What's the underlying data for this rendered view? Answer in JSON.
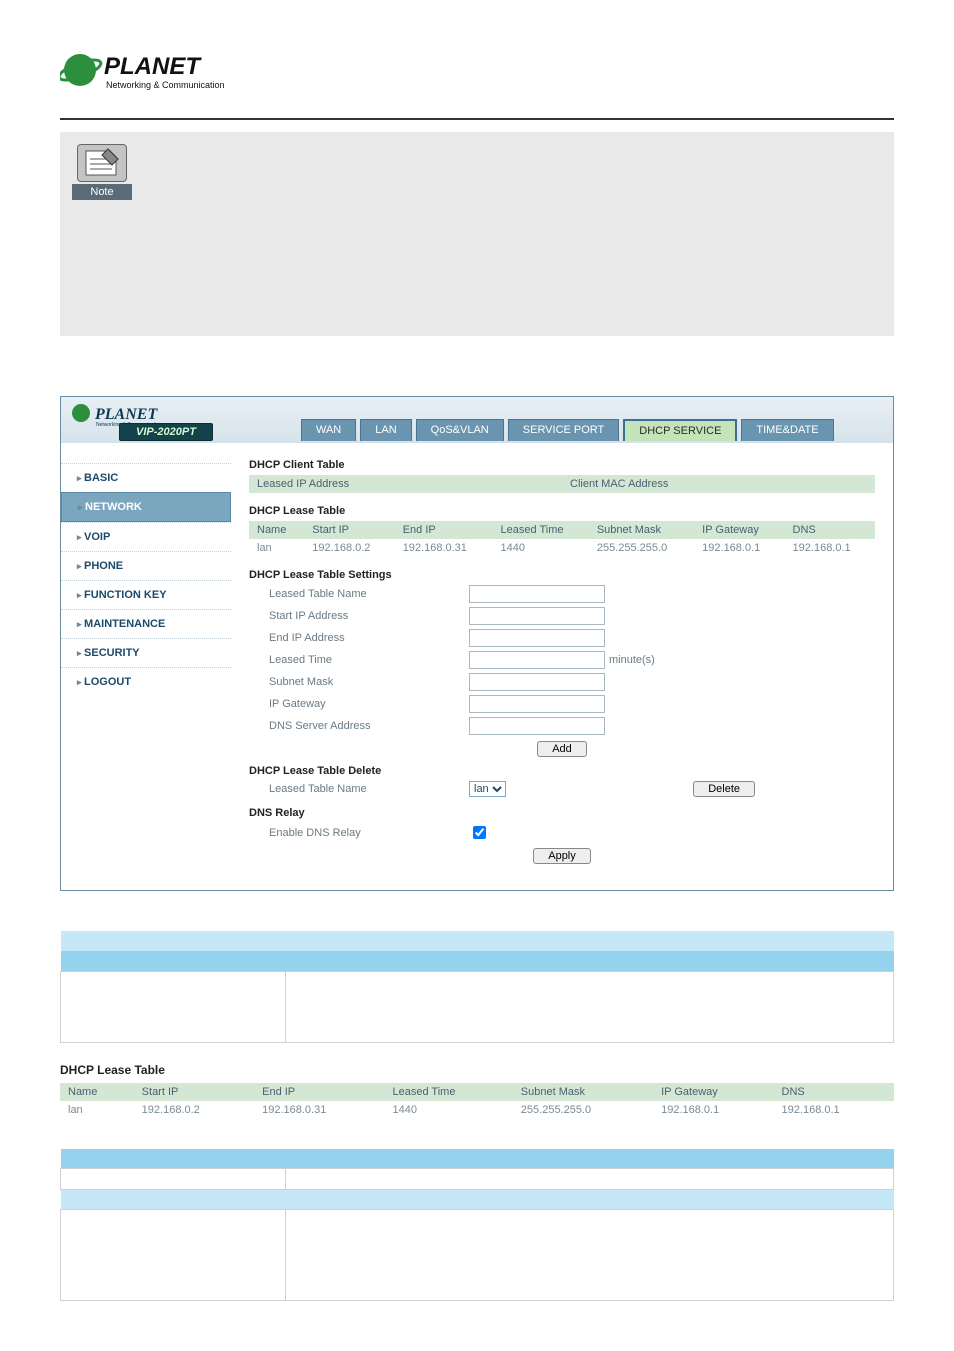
{
  "brand": {
    "name": "PLANET",
    "tagline": "Networking & Communication"
  },
  "note": {
    "label": "Note"
  },
  "app": {
    "model": "VIP-2020PT",
    "tabs": [
      {
        "label": "WAN"
      },
      {
        "label": "LAN"
      },
      {
        "label": "QoS&VLAN"
      },
      {
        "label": "SERVICE PORT"
      },
      {
        "label": "DHCP SERVICE",
        "active": true
      },
      {
        "label": "TIME&DATE"
      }
    ],
    "sidebar": [
      {
        "label": "BASIC"
      },
      {
        "label": "NETWORK",
        "active": true
      },
      {
        "label": "VOIP"
      },
      {
        "label": "PHONE"
      },
      {
        "label": "FUNCTION KEY"
      },
      {
        "label": "MAINTENANCE"
      },
      {
        "label": "SECURITY"
      },
      {
        "label": "LOGOUT"
      }
    ],
    "dhcp_client": {
      "title": "DHCP Client Table",
      "headers": {
        "leased_ip": "Leased IP Address",
        "mac": "Client MAC Address"
      }
    },
    "dhcp_lease": {
      "title": "DHCP Lease Table",
      "headers": {
        "name": "Name",
        "start_ip": "Start IP",
        "end_ip": "End IP",
        "leased_time": "Leased Time",
        "subnet": "Subnet Mask",
        "gateway": "IP Gateway",
        "dns": "DNS"
      },
      "row": {
        "name": "lan",
        "start_ip": "192.168.0.2",
        "end_ip": "192.168.0.31",
        "leased_time": "1440",
        "subnet": "255.255.255.0",
        "gateway": "192.168.0.1",
        "dns": "192.168.0.1"
      }
    },
    "settings": {
      "title": "DHCP Lease Table Settings",
      "labels": {
        "name": "Leased Table Name",
        "start_ip": "Start IP Address",
        "end_ip": "End IP Address",
        "leased_time": "Leased Time",
        "subnet": "Subnet Mask",
        "gateway": "IP Gateway",
        "dns": "DNS Server Address"
      },
      "unit": "minute(s)",
      "add_btn": "Add"
    },
    "delete": {
      "title": "DHCP Lease Table Delete",
      "label": "Leased Table Name",
      "selected": "lan",
      "btn": "Delete"
    },
    "dns_relay": {
      "title": "DNS Relay",
      "label": "Enable DNS Relay",
      "apply_btn": "Apply"
    }
  },
  "lower_lease": {
    "title": "DHCP Lease Table",
    "headers": {
      "name": "Name",
      "start_ip": "Start IP",
      "end_ip": "End IP",
      "leased_time": "Leased Time",
      "subnet": "Subnet Mask",
      "gateway": "IP Gateway",
      "dns": "DNS"
    },
    "row": {
      "name": "lan",
      "start_ip": "192.168.0.2",
      "end_ip": "192.168.0.31",
      "leased_time": "1440",
      "subnet": "255.255.255.0",
      "gateway": "192.168.0.1",
      "dns": "192.168.0.1"
    }
  }
}
